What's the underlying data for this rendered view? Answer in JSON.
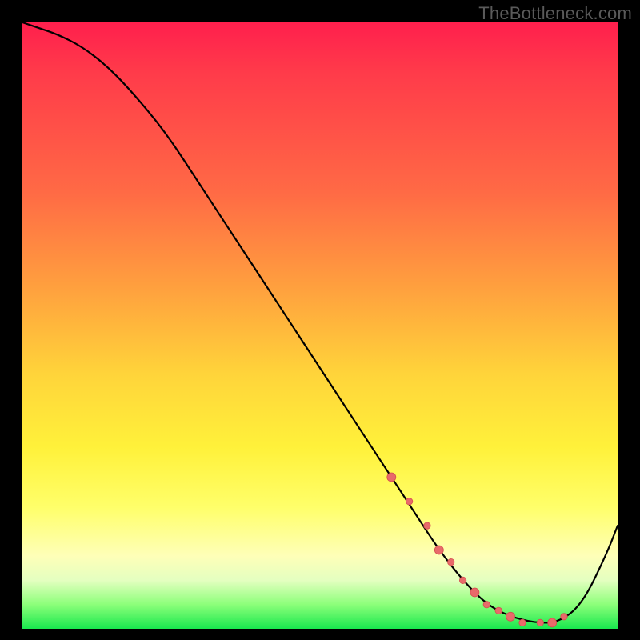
{
  "watermark": "TheBottleneck.com",
  "colors": {
    "curve_stroke": "#000000",
    "marker_fill": "#e86a6a",
    "marker_stroke": "#d44f4f"
  },
  "chart_data": {
    "type": "line",
    "title": "",
    "xlabel": "",
    "ylabel": "",
    "xlim": [
      0,
      100
    ],
    "ylim": [
      0,
      100
    ],
    "grid": false,
    "legend": false,
    "series": [
      {
        "name": "bottleneck-curve",
        "x": [
          0,
          3,
          6,
          10,
          14,
          18,
          24,
          30,
          36,
          42,
          48,
          54,
          58,
          62,
          66,
          70,
          74,
          78,
          82,
          86,
          90,
          94,
          98,
          100
        ],
        "y": [
          100,
          99,
          98,
          96,
          93,
          89,
          82,
          73,
          64,
          55,
          46,
          37,
          31,
          25,
          19,
          13,
          8,
          4,
          2,
          1,
          1,
          4,
          12,
          17
        ]
      }
    ],
    "markers": {
      "name": "highlighted-range",
      "x": [
        62,
        65,
        68,
        70,
        72,
        74,
        76,
        78,
        80,
        82,
        84,
        87,
        89,
        91
      ],
      "y": [
        25,
        21,
        17,
        13,
        11,
        8,
        6,
        4,
        3,
        2,
        1,
        1,
        1,
        2
      ]
    }
  }
}
